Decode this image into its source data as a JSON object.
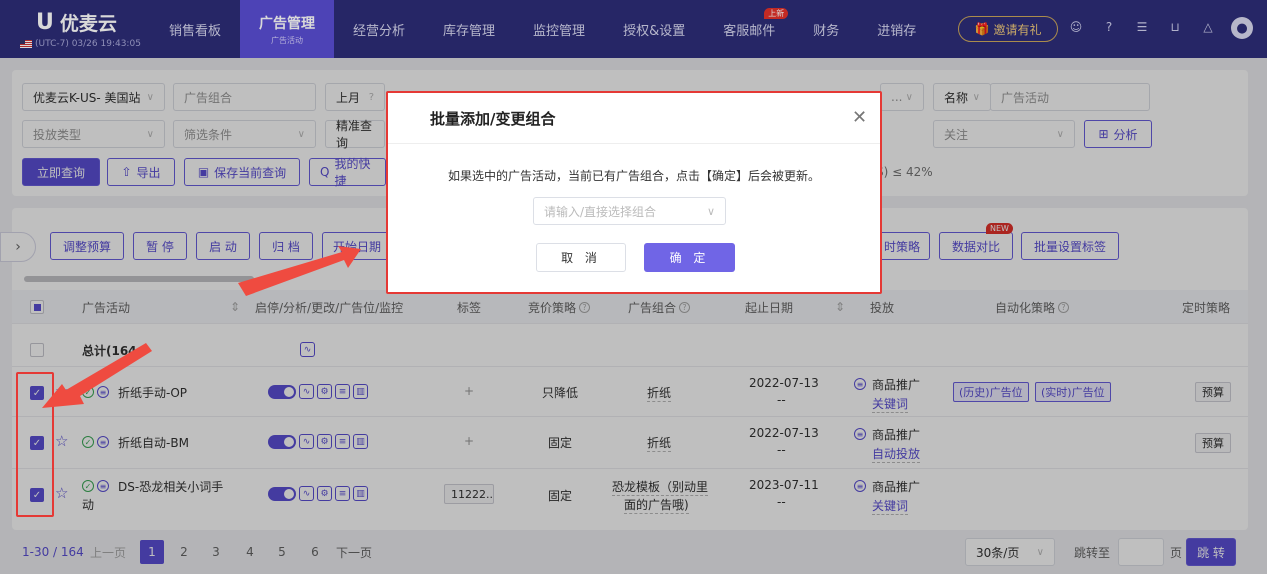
{
  "app": {
    "name": "优麦云",
    "time": "(UTC-7) 03/26 19:43:05"
  },
  "nav": [
    {
      "label": "销售看板"
    },
    {
      "label": "广告管理",
      "sub": "广告活动",
      "active": true
    },
    {
      "label": "经营分析"
    },
    {
      "label": "库存管理"
    },
    {
      "label": "监控管理"
    },
    {
      "label": "授权&设置"
    },
    {
      "label": "客服邮件",
      "badge": "上新"
    },
    {
      "label": "财务"
    },
    {
      "label": "进销存"
    }
  ],
  "header": {
    "invite": "邀请有礼",
    "icons": [
      "user-gear-icon",
      "help-icon",
      "document-icon",
      "cart-icon",
      "bell-icon",
      "avatar-icon"
    ]
  },
  "filters": {
    "shop": "优麦云K-US- 美国站",
    "ad_group_placeholder": "广告组合",
    "period": "上月",
    "name_label": "名称",
    "ad_activity_placeholder": "广告活动",
    "delivery_type": "投放类型",
    "filter_condition": "筛选条件",
    "exact_query": "精准查询",
    "follow": "关注",
    "analyze": "分析",
    "query_btn": "立即查询",
    "export_btn": "导出",
    "save_query_btn": "保存当前查询",
    "my_quick_btn": "我的快捷",
    "acos_text": "S) ≤ 42%"
  },
  "actions": {
    "adjust_budget": "调整预算",
    "pause": "暂 停",
    "start": "启 动",
    "archive": "归 档",
    "start_date": "开始日期",
    "timing_strategy": "时策略",
    "data_compare": "数据对比",
    "new_badge": "NEW",
    "batch_tag": "批量设置标签"
  },
  "table": {
    "headers": {
      "activity": "广告活动",
      "controls": "启停/分析/更改/广告位/监控",
      "tags": "标签",
      "bid": "竞价策略",
      "group": "广告组合",
      "dates": "起止日期",
      "delivery": "投放",
      "auto": "自动化策略",
      "timing": "定时策略"
    },
    "total_label": "总计(164",
    "rows": [
      {
        "name": "折纸手动-OP",
        "tag": "+",
        "bid": "只降低",
        "group": "折纸",
        "date": "2022-07-13",
        "date_end": "--",
        "delivery_type": "商品推广",
        "delivery_sub": "关键词",
        "auto1": "(历史)广告位",
        "auto2": "(实时)广告位",
        "timing": "预算"
      },
      {
        "name": "折纸自动-BM",
        "tag": "+",
        "bid": "固定",
        "group": "折纸",
        "date": "2022-07-13",
        "date_end": "--",
        "delivery_type": "商品推广",
        "delivery_sub": "自动投放",
        "timing": "预算"
      },
      {
        "name": "DS-恐龙相关小词手",
        "name2": "动",
        "tag": "11222..",
        "bid": "固定",
        "group": "恐龙模板（别动里",
        "group2": "面的广告哦)",
        "date": "2023-07-11",
        "date_end": "--",
        "delivery_type": "商品推广",
        "delivery_sub": "关键词"
      }
    ]
  },
  "pager": {
    "summary": "1-30 / 164",
    "prev": "上一页",
    "pages": [
      "1",
      "2",
      "3",
      "4",
      "5",
      "6"
    ],
    "next": "下一页",
    "per_page": "30条/页",
    "jump_to": "跳转至",
    "page_unit": "页",
    "jump_btn": "跳 转"
  },
  "modal": {
    "title": "批量添加/变更组合",
    "message": "如果选中的广告活动，当前已有广告组合，点击【确定】后会被更新。",
    "placeholder": "请输入/直接选择组合",
    "cancel": "取 消",
    "ok": "确 定"
  },
  "colors": {
    "brand": "#5b4fd6",
    "topbar": "#2d2d78",
    "highlight": "#e53935"
  }
}
